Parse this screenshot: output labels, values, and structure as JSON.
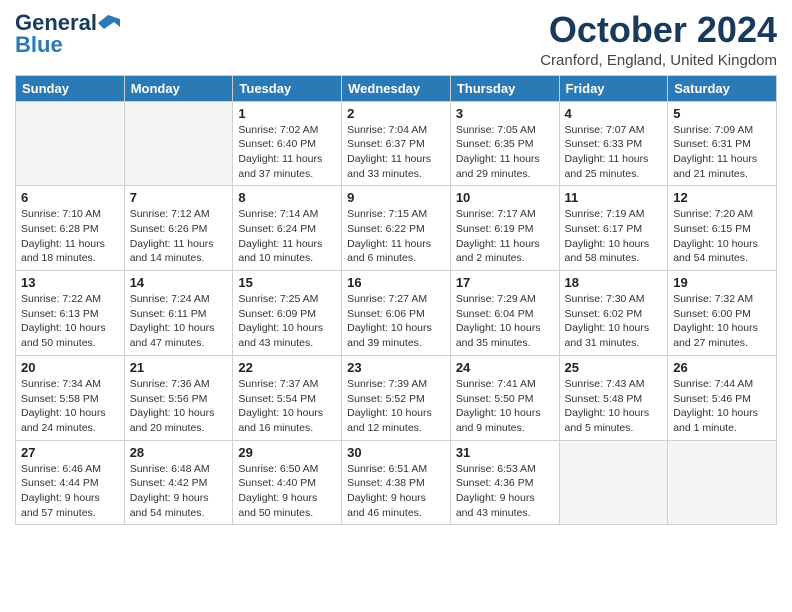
{
  "logo": {
    "general": "General",
    "blue": "Blue"
  },
  "header": {
    "month": "October 2024",
    "location": "Cranford, England, United Kingdom"
  },
  "weekdays": [
    "Sunday",
    "Monday",
    "Tuesday",
    "Wednesday",
    "Thursday",
    "Friday",
    "Saturday"
  ],
  "weeks": [
    [
      {
        "day": "",
        "sunrise": "",
        "sunset": "",
        "daylight": ""
      },
      {
        "day": "",
        "sunrise": "",
        "sunset": "",
        "daylight": ""
      },
      {
        "day": "1",
        "sunrise": "Sunrise: 7:02 AM",
        "sunset": "Sunset: 6:40 PM",
        "daylight": "Daylight: 11 hours and 37 minutes."
      },
      {
        "day": "2",
        "sunrise": "Sunrise: 7:04 AM",
        "sunset": "Sunset: 6:37 PM",
        "daylight": "Daylight: 11 hours and 33 minutes."
      },
      {
        "day": "3",
        "sunrise": "Sunrise: 7:05 AM",
        "sunset": "Sunset: 6:35 PM",
        "daylight": "Daylight: 11 hours and 29 minutes."
      },
      {
        "day": "4",
        "sunrise": "Sunrise: 7:07 AM",
        "sunset": "Sunset: 6:33 PM",
        "daylight": "Daylight: 11 hours and 25 minutes."
      },
      {
        "day": "5",
        "sunrise": "Sunrise: 7:09 AM",
        "sunset": "Sunset: 6:31 PM",
        "daylight": "Daylight: 11 hours and 21 minutes."
      }
    ],
    [
      {
        "day": "6",
        "sunrise": "Sunrise: 7:10 AM",
        "sunset": "Sunset: 6:28 PM",
        "daylight": "Daylight: 11 hours and 18 minutes."
      },
      {
        "day": "7",
        "sunrise": "Sunrise: 7:12 AM",
        "sunset": "Sunset: 6:26 PM",
        "daylight": "Daylight: 11 hours and 14 minutes."
      },
      {
        "day": "8",
        "sunrise": "Sunrise: 7:14 AM",
        "sunset": "Sunset: 6:24 PM",
        "daylight": "Daylight: 11 hours and 10 minutes."
      },
      {
        "day": "9",
        "sunrise": "Sunrise: 7:15 AM",
        "sunset": "Sunset: 6:22 PM",
        "daylight": "Daylight: 11 hours and 6 minutes."
      },
      {
        "day": "10",
        "sunrise": "Sunrise: 7:17 AM",
        "sunset": "Sunset: 6:19 PM",
        "daylight": "Daylight: 11 hours and 2 minutes."
      },
      {
        "day": "11",
        "sunrise": "Sunrise: 7:19 AM",
        "sunset": "Sunset: 6:17 PM",
        "daylight": "Daylight: 10 hours and 58 minutes."
      },
      {
        "day": "12",
        "sunrise": "Sunrise: 7:20 AM",
        "sunset": "Sunset: 6:15 PM",
        "daylight": "Daylight: 10 hours and 54 minutes."
      }
    ],
    [
      {
        "day": "13",
        "sunrise": "Sunrise: 7:22 AM",
        "sunset": "Sunset: 6:13 PM",
        "daylight": "Daylight: 10 hours and 50 minutes."
      },
      {
        "day": "14",
        "sunrise": "Sunrise: 7:24 AM",
        "sunset": "Sunset: 6:11 PM",
        "daylight": "Daylight: 10 hours and 47 minutes."
      },
      {
        "day": "15",
        "sunrise": "Sunrise: 7:25 AM",
        "sunset": "Sunset: 6:09 PM",
        "daylight": "Daylight: 10 hours and 43 minutes."
      },
      {
        "day": "16",
        "sunrise": "Sunrise: 7:27 AM",
        "sunset": "Sunset: 6:06 PM",
        "daylight": "Daylight: 10 hours and 39 minutes."
      },
      {
        "day": "17",
        "sunrise": "Sunrise: 7:29 AM",
        "sunset": "Sunset: 6:04 PM",
        "daylight": "Daylight: 10 hours and 35 minutes."
      },
      {
        "day": "18",
        "sunrise": "Sunrise: 7:30 AM",
        "sunset": "Sunset: 6:02 PM",
        "daylight": "Daylight: 10 hours and 31 minutes."
      },
      {
        "day": "19",
        "sunrise": "Sunrise: 7:32 AM",
        "sunset": "Sunset: 6:00 PM",
        "daylight": "Daylight: 10 hours and 27 minutes."
      }
    ],
    [
      {
        "day": "20",
        "sunrise": "Sunrise: 7:34 AM",
        "sunset": "Sunset: 5:58 PM",
        "daylight": "Daylight: 10 hours and 24 minutes."
      },
      {
        "day": "21",
        "sunrise": "Sunrise: 7:36 AM",
        "sunset": "Sunset: 5:56 PM",
        "daylight": "Daylight: 10 hours and 20 minutes."
      },
      {
        "day": "22",
        "sunrise": "Sunrise: 7:37 AM",
        "sunset": "Sunset: 5:54 PM",
        "daylight": "Daylight: 10 hours and 16 minutes."
      },
      {
        "day": "23",
        "sunrise": "Sunrise: 7:39 AM",
        "sunset": "Sunset: 5:52 PM",
        "daylight": "Daylight: 10 hours and 12 minutes."
      },
      {
        "day": "24",
        "sunrise": "Sunrise: 7:41 AM",
        "sunset": "Sunset: 5:50 PM",
        "daylight": "Daylight: 10 hours and 9 minutes."
      },
      {
        "day": "25",
        "sunrise": "Sunrise: 7:43 AM",
        "sunset": "Sunset: 5:48 PM",
        "daylight": "Daylight: 10 hours and 5 minutes."
      },
      {
        "day": "26",
        "sunrise": "Sunrise: 7:44 AM",
        "sunset": "Sunset: 5:46 PM",
        "daylight": "Daylight: 10 hours and 1 minute."
      }
    ],
    [
      {
        "day": "27",
        "sunrise": "Sunrise: 6:46 AM",
        "sunset": "Sunset: 4:44 PM",
        "daylight": "Daylight: 9 hours and 57 minutes."
      },
      {
        "day": "28",
        "sunrise": "Sunrise: 6:48 AM",
        "sunset": "Sunset: 4:42 PM",
        "daylight": "Daylight: 9 hours and 54 minutes."
      },
      {
        "day": "29",
        "sunrise": "Sunrise: 6:50 AM",
        "sunset": "Sunset: 4:40 PM",
        "daylight": "Daylight: 9 hours and 50 minutes."
      },
      {
        "day": "30",
        "sunrise": "Sunrise: 6:51 AM",
        "sunset": "Sunset: 4:38 PM",
        "daylight": "Daylight: 9 hours and 46 minutes."
      },
      {
        "day": "31",
        "sunrise": "Sunrise: 6:53 AM",
        "sunset": "Sunset: 4:36 PM",
        "daylight": "Daylight: 9 hours and 43 minutes."
      },
      {
        "day": "",
        "sunrise": "",
        "sunset": "",
        "daylight": ""
      },
      {
        "day": "",
        "sunrise": "",
        "sunset": "",
        "daylight": ""
      }
    ]
  ]
}
